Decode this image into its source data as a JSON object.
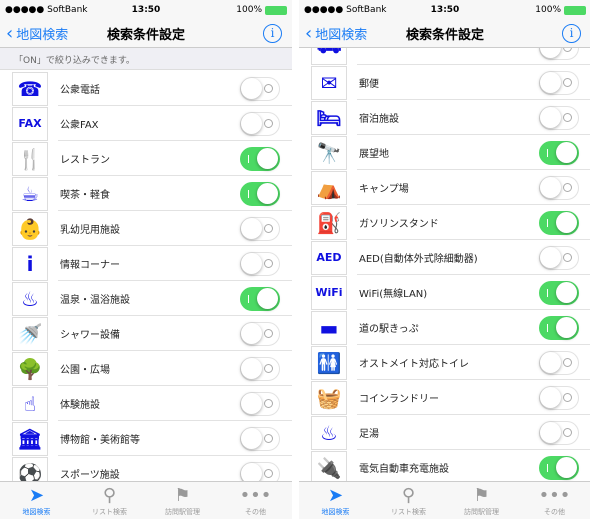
{
  "status": {
    "carrier": "●●●●● SoftBank",
    "time": "13:50",
    "battery": "100%"
  },
  "nav": {
    "back": "地図検索",
    "title": "検索条件設定",
    "info": "i"
  },
  "hint": "「ON」で絞り込みできます。",
  "tabs": [
    {
      "label": "地図検索",
      "icon": "➤",
      "active": true
    },
    {
      "label": "リスト検索",
      "icon": "⚲"
    },
    {
      "label": "訪問駅管理",
      "icon": "⚑"
    },
    {
      "label": "その他",
      "icon": "•••"
    }
  ],
  "left_items": [
    {
      "label": "公衆電話",
      "icon": "☎",
      "on": false
    },
    {
      "label": "公衆FAX",
      "icon": "FAX",
      "on": false
    },
    {
      "label": "レストラン",
      "icon": "🍴",
      "on": true
    },
    {
      "label": "喫茶・軽食",
      "icon": "☕",
      "on": true
    },
    {
      "label": "乳幼児用施設",
      "icon": "👶",
      "on": false
    },
    {
      "label": "情報コーナー",
      "icon": "i",
      "on": false
    },
    {
      "label": "温泉・温浴施設",
      "icon": "♨",
      "on": true
    },
    {
      "label": "シャワー設備",
      "icon": "🚿",
      "on": false
    },
    {
      "label": "公園・広場",
      "icon": "🌳",
      "on": false
    },
    {
      "label": "体験施設",
      "icon": "☝",
      "on": false
    },
    {
      "label": "博物館・美術館等",
      "icon": "🏛",
      "on": false
    },
    {
      "label": "スポーツ施設",
      "icon": "⚽",
      "on": false
    }
  ],
  "right_items": [
    {
      "label": "",
      "icon": "⛟",
      "on": false
    },
    {
      "label": "郵便",
      "icon": "✉",
      "on": false
    },
    {
      "label": "宿泊施設",
      "icon": "🛏",
      "on": false
    },
    {
      "label": "展望地",
      "icon": "🔭",
      "on": true
    },
    {
      "label": "キャンプ場",
      "icon": "⛺",
      "on": false
    },
    {
      "label": "ガソリンスタンド",
      "icon": "⛽",
      "on": true
    },
    {
      "label": "AED(自動体外式除細動器)",
      "icon": "AED",
      "on": false
    },
    {
      "label": "WiFi(無線LAN)",
      "icon": "WiFi",
      "on": true
    },
    {
      "label": "道の駅きっぷ",
      "icon": "▬",
      "on": true
    },
    {
      "label": "オストメイト対応トイレ",
      "icon": "🚻",
      "on": false
    },
    {
      "label": "コインランドリー",
      "icon": "🧺",
      "on": false
    },
    {
      "label": "足湯",
      "icon": "♨",
      "on": false
    },
    {
      "label": "電気自動車充電施設",
      "icon": "🔌",
      "on": true
    }
  ],
  "colors": {
    "accent": "#1a7cf5",
    "toggle_on": "#4cd964",
    "icon": "#1010e0"
  }
}
